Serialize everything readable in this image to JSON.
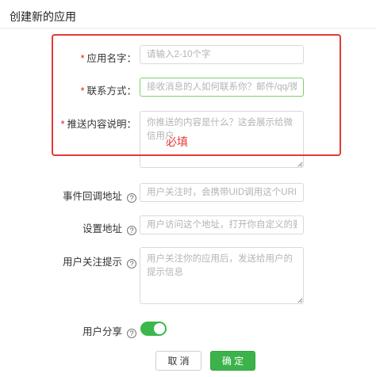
{
  "page": {
    "title": "创建新的应用"
  },
  "form": {
    "app_name": {
      "label": "应用名字：",
      "required_mark": "*",
      "placeholder": "请输入2-10个字",
      "value": ""
    },
    "contact": {
      "label": "联系方式：",
      "required_mark": "*",
      "placeholder": "接收消息的人如何联系你？邮件/qq/微...",
      "value": ""
    },
    "description": {
      "label": "推送内容说明：",
      "required_mark": "*",
      "placeholder": "你推送的内容是什么？这会展示给微信用户",
      "value": ""
    },
    "callback_url": {
      "label": "事件回调地址",
      "help_icon": "?",
      "placeholder": "用户关注时，会携带UID调用这个URI",
      "value": ""
    },
    "setting_url": {
      "label": "设置地址",
      "help_icon": "?",
      "placeholder": "用户访问这个地址，打开你自定义的要...",
      "value": ""
    },
    "follow_tip": {
      "label": "用户关注提示",
      "help_icon": "?",
      "placeholder": "用户关注你的应用后，发送给用户的提示信息",
      "value": ""
    },
    "user_share": {
      "label": "用户分享",
      "help_icon": "?",
      "enabled": true
    }
  },
  "annotation": {
    "text": "必填",
    "color": "#e53935"
  },
  "buttons": {
    "cancel": "取 消",
    "confirm": "确 定"
  },
  "colors": {
    "accent": "#3cb34a",
    "required": "#e02020"
  }
}
